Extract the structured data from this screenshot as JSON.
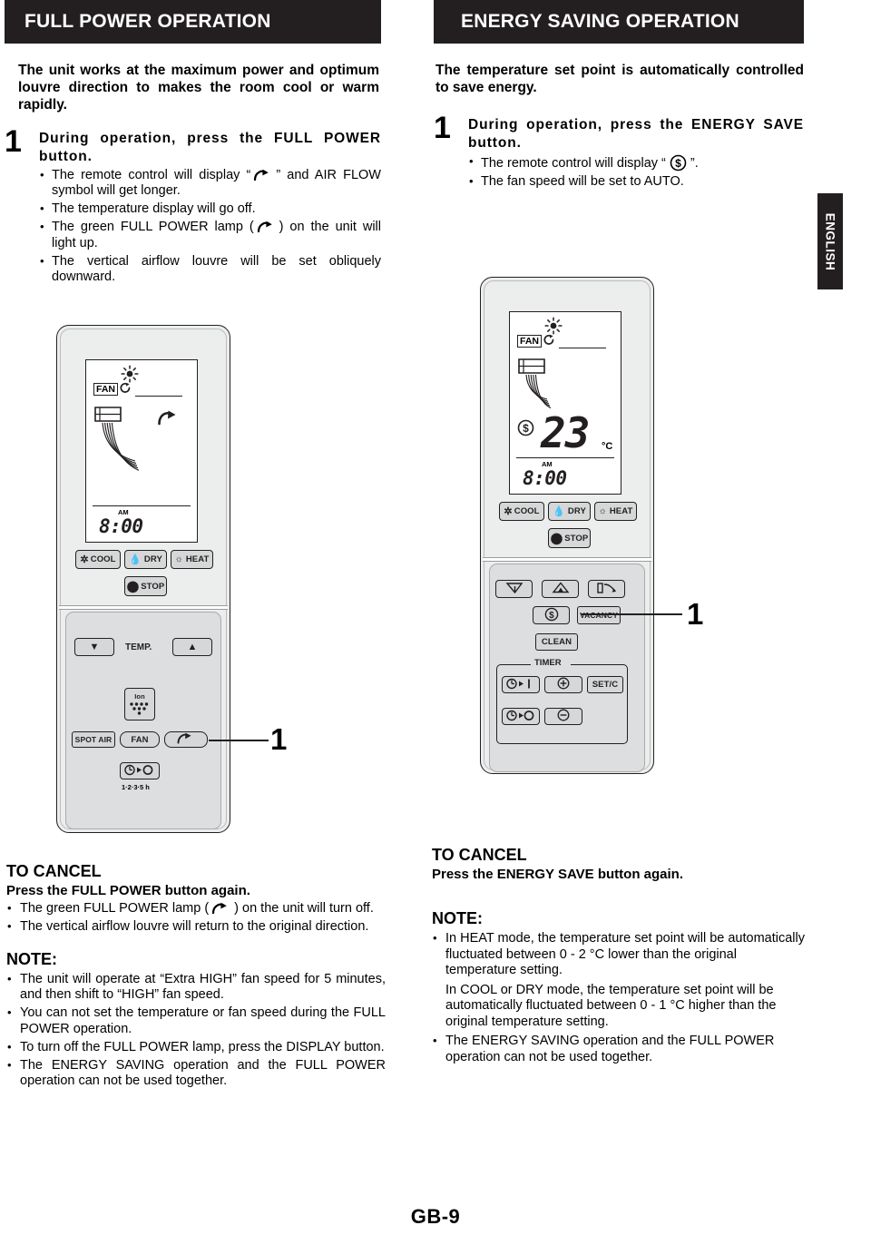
{
  "page": {
    "footer": "GB-9",
    "side_tab": "ENGLISH"
  },
  "left_column": {
    "header": "FULL POWER OPERATION",
    "intro": "The unit works at the maximum power and optimum louvre direction to makes the room cool or warm rapidly.",
    "step": {
      "number": "1",
      "title": "During operation, press the FULL POWER button.",
      "bullets": [
        {
          "pre": "The remote control will display “",
          "icon": "full-power-icon",
          "post": "” and AIR FLOW symbol will get longer."
        },
        {
          "text": "The temperature display will go off."
        },
        {
          "pre": "The green FULL POWER lamp (",
          "icon": "full-power-icon",
          "post": ") on the unit will light up."
        },
        {
          "text": "The vertical airflow louvre will be set obliquely downward."
        }
      ]
    },
    "cancel": {
      "title": "TO CANCEL",
      "subtitle": "Press the FULL POWER button again.",
      "bullets": [
        {
          "pre": "The green FULL POWER lamp (",
          "icon": "full-power-icon",
          "post": ") on the unit will turn off."
        },
        {
          "text": "The vertical airflow louvre will return to the original direction."
        }
      ]
    },
    "note": {
      "title": "NOTE:",
      "bullets": [
        "The unit will operate at “Extra HIGH” fan speed for 5 minutes, and then shift to “HIGH” fan speed.",
        "You can not set the temperature or fan speed during the FULL POWER operation.",
        "To turn off the FULL POWER lamp, press the DISPLAY button.",
        "The ENERGY SAVING operation and the FULL POWER operation can not be used together."
      ]
    },
    "callout": "1"
  },
  "right_column": {
    "header": "ENERGY SAVING OPERATION",
    "intro": "The temperature set point is automatically controlled to save energy.",
    "step": {
      "number": "1",
      "title": "During operation, press the ENERGY SAVE button.",
      "bullets": [
        {
          "pre": "The remote control will display “",
          "icon": "dollar-icon",
          "post": "”."
        },
        {
          "text": "The fan speed will be set to AUTO."
        }
      ]
    },
    "cancel": {
      "title": "TO CANCEL",
      "subtitle": "Press the ENERGY SAVE button again."
    },
    "note": {
      "title": "NOTE:",
      "bullets": [
        {
          "bullet": true,
          "text": "In HEAT mode, the temperature set point will be automatically fluctuated between 0 - 2 °C lower than the original temperature setting."
        },
        {
          "bullet": false,
          "text": "In COOL or DRY mode, the temperature set point will be automatically fluctuated between 0 - 1 °C higher than the original temperature setting."
        },
        {
          "bullet": true,
          "text": "The ENERGY SAVING operation and the FULL POWER operation can not be used together."
        }
      ]
    },
    "callout": "1"
  },
  "remote_left": {
    "lcd": {
      "mode_icon": "sun-icon",
      "fan_label": "FAN",
      "fan_auto_icon": "auto-recycle-icon",
      "louvre_icon": "airflow-louvre-icon",
      "full_power_icon": "full-power-icon",
      "temperature": "",
      "temp_unit": "",
      "am_label": "AM",
      "clock": "8:00"
    },
    "buttons": {
      "cool": "COOL",
      "dry": "DRY",
      "heat": "HEAT",
      "stop": "STOP",
      "temp_label": "TEMP.",
      "temp_down_icon": "arrow-down-icon",
      "temp_up_icon": "arrow-up-icon",
      "ion_label": "Ion",
      "spot_air": "SPOT AIR",
      "fan": "FAN",
      "full_power_icon": "full-power-icon",
      "timer_off_icon": "timer-off-icon",
      "timer_hours": "1·2·3·5 h"
    }
  },
  "remote_right": {
    "lcd": {
      "mode_icon": "sun-icon",
      "fan_label": "FAN",
      "fan_auto_icon": "auto-recycle-icon",
      "louvre_icon": "airflow-louvre-icon",
      "energy_save_icon": "dollar-icon",
      "temperature": "23",
      "temp_unit": "°C",
      "am_label": "AM",
      "clock": "8:00"
    },
    "buttons": {
      "cool": "COOL",
      "dry": "DRY",
      "heat": "HEAT",
      "stop": "STOP",
      "louvre_icon": "louvre-swing-icon",
      "coanda_icon": "coanda-airflow-icon",
      "sensor_icon": "sensor-airflow-icon",
      "energy_save_icon": "dollar-icon",
      "vacancy": "VACANCY",
      "clean": "CLEAN",
      "timer_label": "TIMER",
      "timer_on_icon": "timer-on-icon",
      "timer_off_icon": "timer-off-icon",
      "plus_icon": "plus-icon",
      "minus_icon": "minus-icon",
      "setc": "SET/C"
    }
  }
}
